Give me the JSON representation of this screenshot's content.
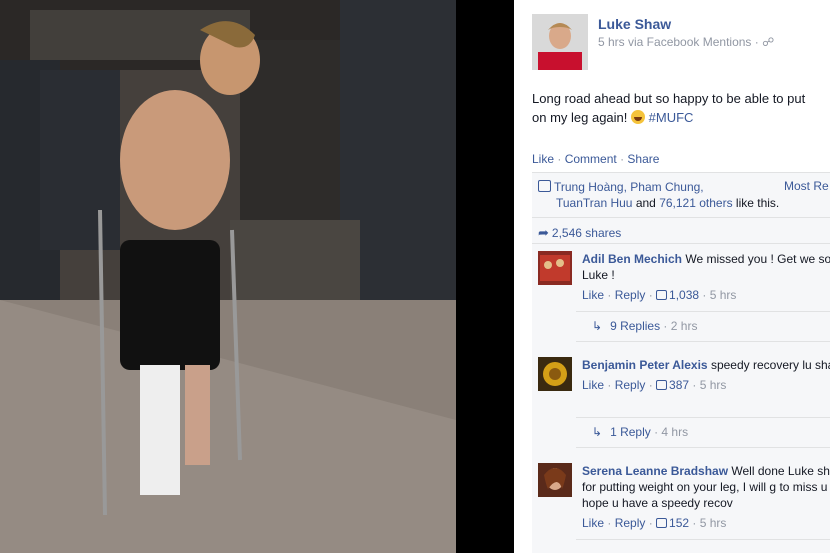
{
  "photo": {
    "alt": "man on crutches with leg cast"
  },
  "post": {
    "author": "Luke Shaw",
    "meta": "5 hrs via Facebook Mentions ·",
    "text_line1": "Long road ahead but so happy to be able to put",
    "text_line2": "on my leg again!",
    "hashtag": "#MUFC",
    "actions": {
      "like": "Like",
      "comment": "Comment",
      "share": "Share"
    }
  },
  "ufi": {
    "likers_line1": "Trung Hoàng, Pham Chung,",
    "likers_line2_a": "TuanTran Huu",
    "likers_line2_b": " and ",
    "likers_line2_c": "76,121 others",
    "likers_line2_d": " like this.",
    "most_relevant": "Most Re",
    "shares": "2,546 shares"
  },
  "comments": [
    {
      "author": "Adil Ben Mechich",
      "text": " We missed you ! Get we soon Luke !",
      "like": "Like",
      "reply": "Reply",
      "likes": "1,038",
      "time": "5 hrs",
      "replies": "9 Replies",
      "replies_time": "2 hrs"
    },
    {
      "author": "Benjamin Peter Alexis",
      "text": " speedy recovery lu shaw",
      "like": "Like",
      "reply": "Reply",
      "likes": "387",
      "time": "5 hrs",
      "replies": "1 Reply",
      "replies_time": "4 hrs"
    },
    {
      "author": "Serena Leanne Bradshaw",
      "text": " Well done Luke shaw for putting weight on your leg, I will g to miss u and hope u have a speedy recov",
      "like": "Like",
      "reply": "Reply",
      "likes": "152",
      "time": "5 hrs"
    }
  ],
  "colors": {
    "link": "#3b5998",
    "muted": "#9197a3",
    "text": "#141823",
    "ufi_bg": "#f6f7f9"
  }
}
